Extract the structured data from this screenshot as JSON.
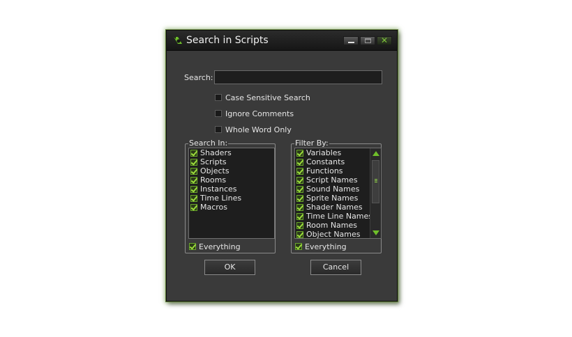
{
  "window": {
    "title": "Search in Scripts",
    "accent_color": "#6fbf2a"
  },
  "search": {
    "label": "Search:",
    "value": ""
  },
  "options": [
    {
      "label": "Case Sensitive Search",
      "checked": false
    },
    {
      "label": "Ignore Comments",
      "checked": false
    },
    {
      "label": "Whole Word Only",
      "checked": false
    }
  ],
  "search_in": {
    "legend": "Search In:",
    "items": [
      {
        "label": "Shaders",
        "checked": true
      },
      {
        "label": "Scripts",
        "checked": true
      },
      {
        "label": "Objects",
        "checked": true
      },
      {
        "label": "Rooms",
        "checked": true
      },
      {
        "label": "Instances",
        "checked": true
      },
      {
        "label": "Time Lines",
        "checked": true
      },
      {
        "label": "Macros",
        "checked": true
      }
    ],
    "everything_label": "Everything"
  },
  "filter_by": {
    "legend": "Filter By:",
    "items": [
      {
        "label": "Variables",
        "checked": true
      },
      {
        "label": "Constants",
        "checked": true
      },
      {
        "label": "Functions",
        "checked": true
      },
      {
        "label": "Script Names",
        "checked": true
      },
      {
        "label": "Sound Names",
        "checked": true
      },
      {
        "label": "Sprite Names",
        "checked": true
      },
      {
        "label": "Shader Names",
        "checked": true
      },
      {
        "label": "Time Line Names",
        "checked": true
      },
      {
        "label": "Room Names",
        "checked": true
      },
      {
        "label": "Object Names",
        "checked": true
      }
    ],
    "everything_label": "Everything"
  },
  "buttons": {
    "ok": "OK",
    "cancel": "Cancel"
  }
}
